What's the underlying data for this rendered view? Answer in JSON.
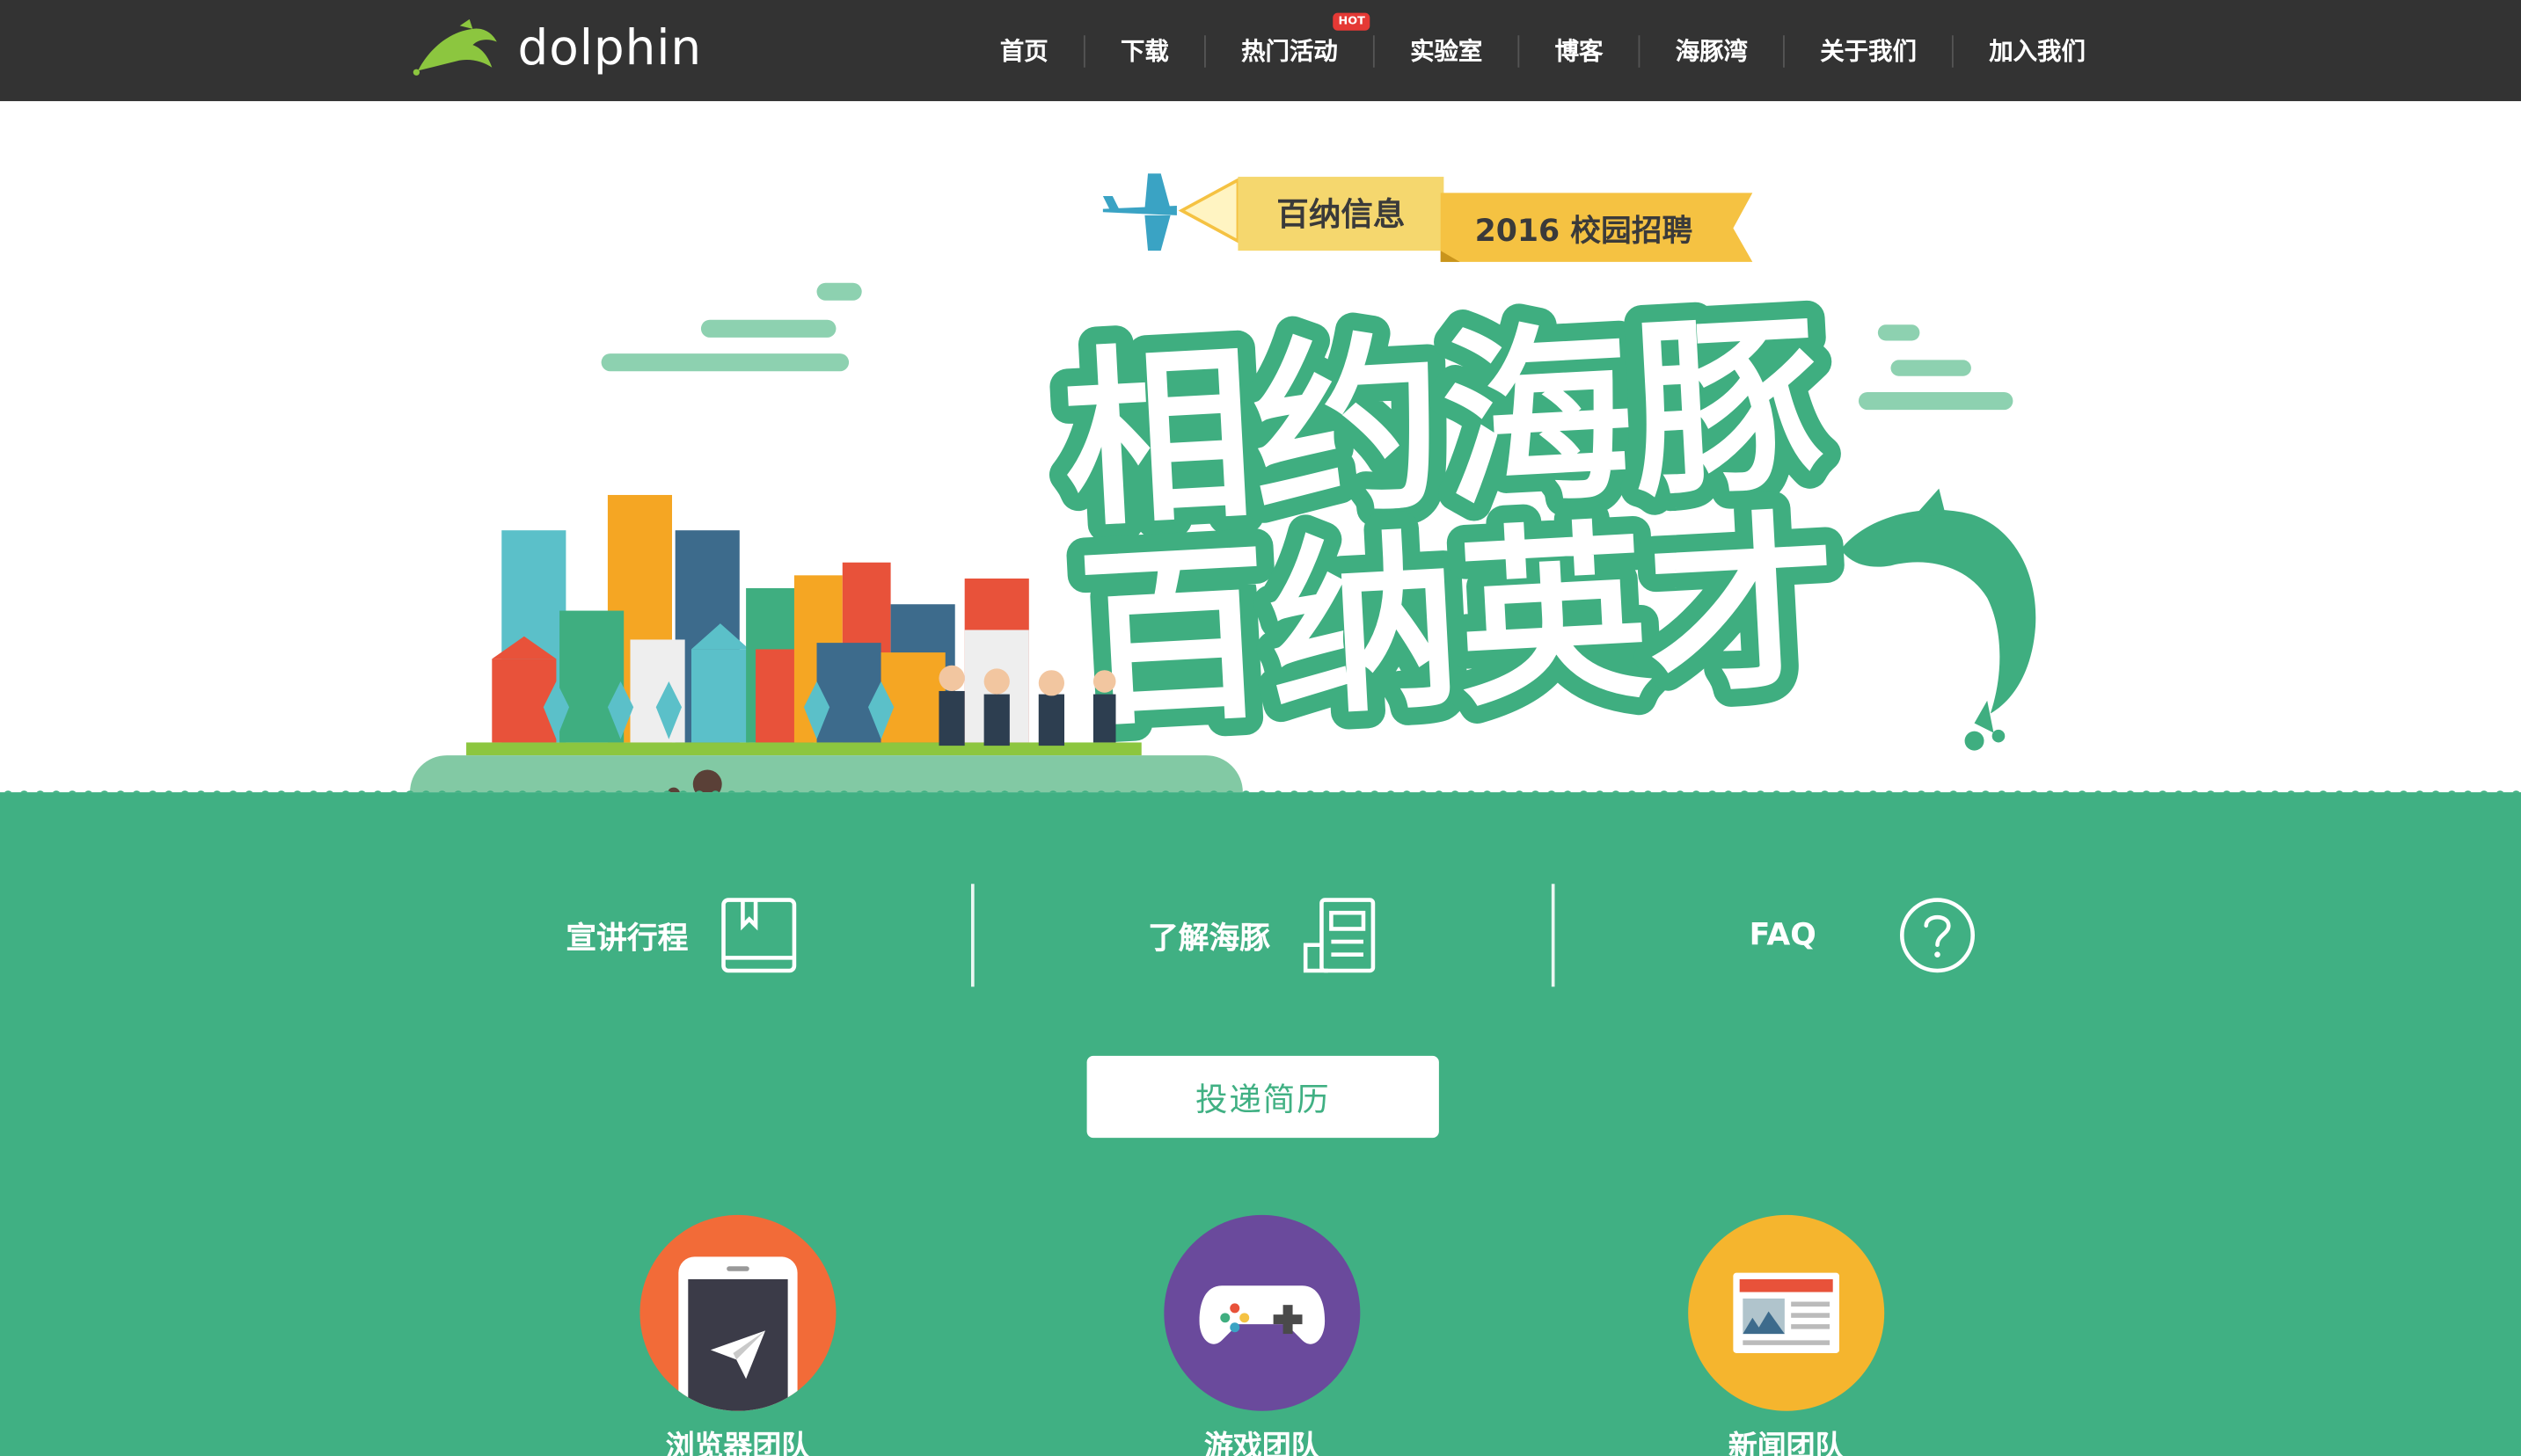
{
  "header": {
    "logo_text": "dolphin",
    "nav": [
      {
        "label": "首页"
      },
      {
        "label": "下载"
      },
      {
        "label": "热门活动",
        "badge": "HOT"
      },
      {
        "label": "实验室"
      },
      {
        "label": "博客"
      },
      {
        "label": "海豚湾"
      },
      {
        "label": "关于我们"
      },
      {
        "label": "加入我们"
      }
    ]
  },
  "banner": {
    "company": "百纳信息",
    "campaign": "2016 校园招聘",
    "headline_line1": "相约海豚",
    "headline_line2": "百纳英才"
  },
  "quick_links": [
    {
      "label": "宣讲行程",
      "icon": "book-icon"
    },
    {
      "label": "了解海豚",
      "icon": "document-icon"
    },
    {
      "label": "FAQ",
      "icon": "question-icon"
    }
  ],
  "cta": {
    "label": "投递简历"
  },
  "teams": [
    {
      "label": "浏览器团队",
      "icon": "tablet-send-icon",
      "color": "#f26b38"
    },
    {
      "label": "游戏团队",
      "icon": "gamepad-icon",
      "color": "#6a4a9c"
    },
    {
      "label": "新闻团队",
      "icon": "newspaper-icon",
      "color": "#f5b52e"
    }
  ],
  "colors": {
    "header_bg": "#333333",
    "brand_green": "#40b083",
    "headline_green": "#3fae80",
    "ribbon_yellow": "#f5c242",
    "hot_badge": "#e53935"
  }
}
